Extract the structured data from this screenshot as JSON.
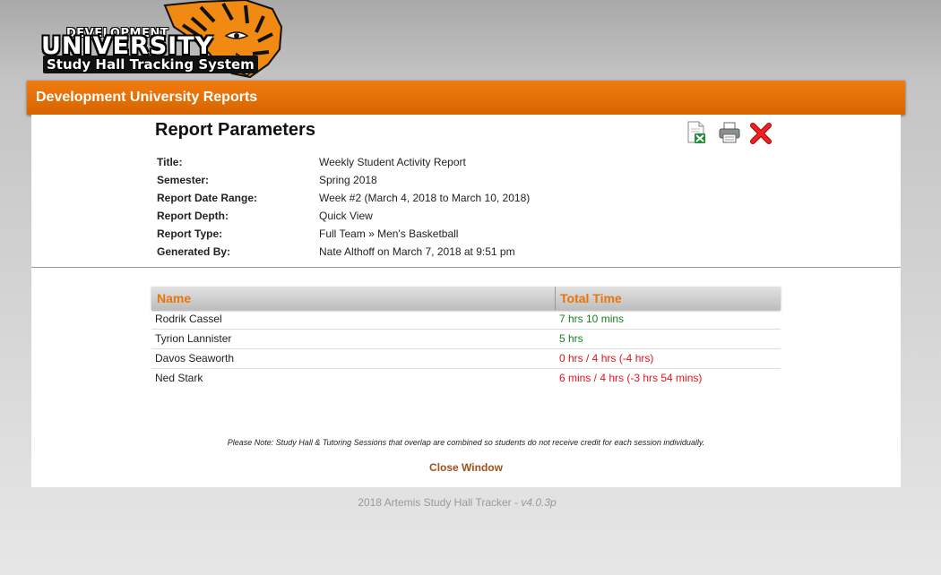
{
  "logo": {
    "line1": "DEVELOPMENT",
    "line2": "UNIVERSITY",
    "line3": "Study Hall Tracking System"
  },
  "header": {
    "title": "Development University Reports"
  },
  "report": {
    "heading": "Report Parameters",
    "toolbar": {
      "export_icon": "excel-export-icon",
      "print_icon": "printer-icon",
      "close_icon": "close-x-icon"
    },
    "params": [
      {
        "label": "Title:",
        "value": "Weekly Student Activity Report"
      },
      {
        "label": "Semester:",
        "value": "Spring 2018"
      },
      {
        "label": "Report Date Range:",
        "value": "Week #2 (March 4, 2018 to March 10, 2018)"
      },
      {
        "label": "Report Depth:",
        "value": "Quick View"
      },
      {
        "label": "Report Type:",
        "value": "Full Team » Men's Basketball"
      },
      {
        "label": "Generated By:",
        "value": "Nate Althoff on March 7, 2018 at 9:51 pm"
      }
    ]
  },
  "table": {
    "columns": [
      "Name",
      "Total Time"
    ],
    "rows": [
      {
        "name": "Rodrik Cassel",
        "time": "7 hrs 10 mins",
        "status": "ok"
      },
      {
        "name": "Tyrion Lannister",
        "time": "5 hrs",
        "status": "ok"
      },
      {
        "name": "Davos Seaworth",
        "time": "0 hrs / 4 hrs  (-4 hrs)",
        "status": "bad"
      },
      {
        "name": "Ned Stark",
        "time": "6 mins / 4 hrs  (-3 hrs 54 mins)",
        "status": "bad"
      }
    ]
  },
  "note": "Please Note: Study Hall & Tutoring Sessions that overlap are combined so students do not receive credit for each session individually.",
  "close_window": "Close Window",
  "footer": {
    "text": "2018 Artemis Study Hall Tracker - ",
    "version": "v4.0.3p"
  },
  "colors": {
    "accent": "#e87506",
    "ok": "#1a7f1a",
    "bad": "#e0141c",
    "link": "#a0501a"
  }
}
